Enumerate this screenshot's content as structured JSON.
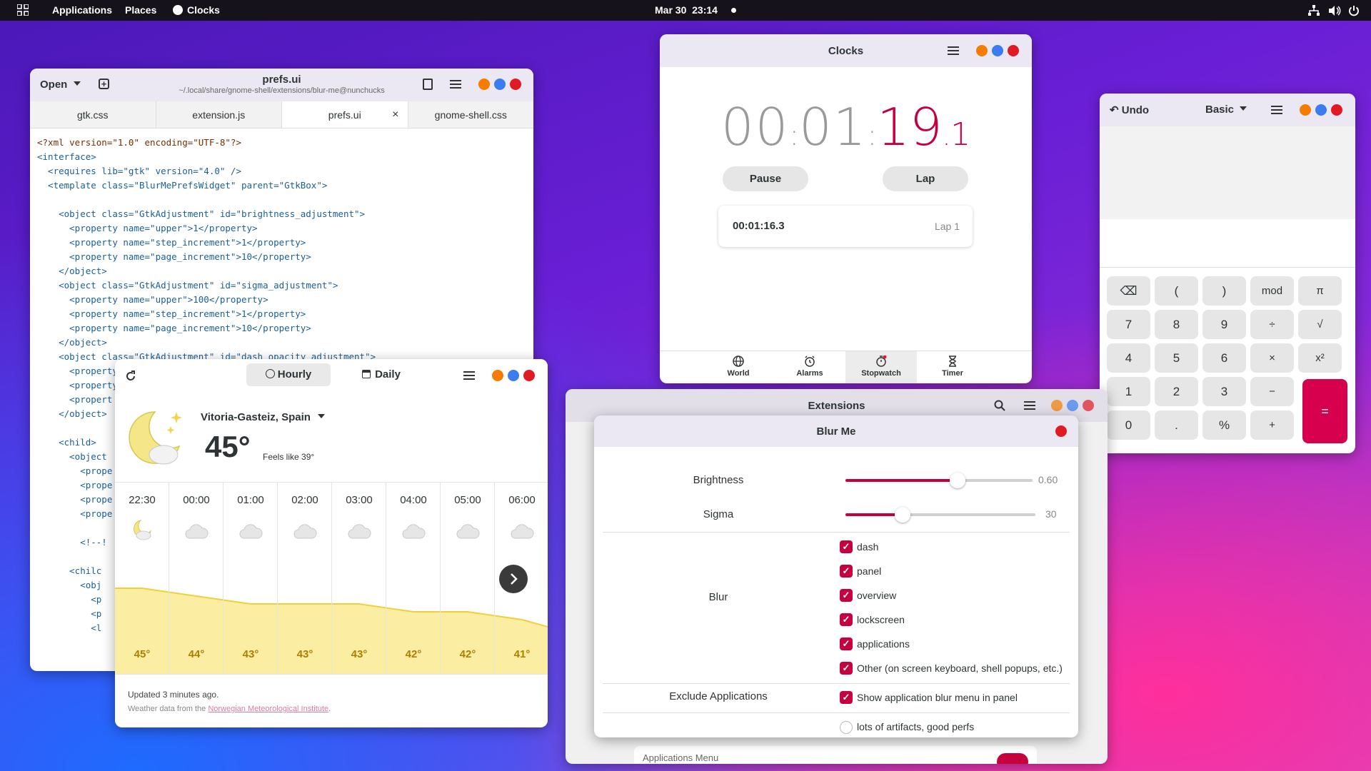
{
  "topbar": {
    "activities_icon": "grid-icon",
    "applications": "Applications",
    "places": "Places",
    "app": "Clocks",
    "clock": "Mar 30  23:14",
    "network_icon": "network-icon",
    "volume_icon": "volume-icon",
    "power_icon": "power-icon"
  },
  "editor": {
    "open": "Open",
    "title": "prefs.ui",
    "subtitle": "~/.local/share/gnome-shell/extensions/blur-me@nunchucks",
    "tabs": [
      {
        "label": "gtk.css"
      },
      {
        "label": "extension.js"
      },
      {
        "label": "prefs.ui",
        "active": true,
        "close": "×"
      },
      {
        "label": "gnome-shell.css"
      }
    ],
    "lines": [
      "<?xml version=\"1.0\" encoding=\"UTF-8\"?>",
      "<interface>",
      "  <requires lib=\"gtk\" version=\"4.0\" />",
      "  <template class=\"BlurMePrefsWidget\" parent=\"GtkBox\">",
      "",
      "    <object class=\"GtkAdjustment\" id=\"brightness_adjustment\">",
      "      <property name=\"upper\">1</property>",
      "      <property name=\"step_increment\">1</property>",
      "      <property name=\"page_increment\">10</property>",
      "    </object>",
      "    <object class=\"GtkAdjustment\" id=\"sigma_adjustment\">",
      "      <property name=\"upper\">100</property>",
      "      <property name=\"step_increment\">1</property>",
      "      <property name=\"page_increment\">10</property>",
      "    </object>",
      "    <object class=\"GtkAdjustment\" id=\"dash_opacity_adjustment\">",
      "      <property name=\"upper\">1</property>",
      "      <property name=\"step_increment\">1</property>",
      "      <propert",
      "    </object>",
      "",
      "    <child>",
      "      <object",
      "        <prope",
      "        <prope",
      "        <prope",
      "        <prope",
      "",
      "        <!--!",
      "",
      "      <chilc",
      "        <obj",
      "          <p",
      "          <p",
      "          <l"
    ]
  },
  "clocks": {
    "title": "Clocks",
    "hours": "00",
    "minutes": "01",
    "seconds": "19",
    "tenths": "1",
    "pause": "Pause",
    "lap": "Lap",
    "lap_time": "00:01:16.3",
    "lap_label": "Lap 1",
    "nav": [
      {
        "label": "World",
        "icon": "globe-icon"
      },
      {
        "label": "Alarms",
        "icon": "alarm-icon"
      },
      {
        "label": "Stopwatch",
        "icon": "stopwatch-icon",
        "active": true
      },
      {
        "label": "Timer",
        "icon": "hourglass-icon"
      }
    ]
  },
  "calculator": {
    "undo": "Undo",
    "mode": "Basic",
    "keys": [
      [
        "⌫",
        "(",
        ")",
        "mod",
        "π"
      ],
      [
        "7",
        "8",
        "9",
        "÷",
        "√"
      ],
      [
        "4",
        "5",
        "6",
        "×",
        "x²"
      ],
      [
        "1",
        "2",
        "3",
        "−",
        ""
      ],
      [
        "0",
        ".",
        "%",
        "+",
        ""
      ]
    ],
    "equals": "="
  },
  "weather": {
    "hourly": "Hourly",
    "daily": "Daily",
    "location": "Vitoria-Gasteiz, Spain",
    "temp": "45°",
    "feels": "Feels like 39°",
    "hours": [
      {
        "time": "22:30",
        "temp": "45°"
      },
      {
        "time": "00:00",
        "temp": "44°"
      },
      {
        "time": "01:00",
        "temp": "43°"
      },
      {
        "time": "02:00",
        "temp": "43°"
      },
      {
        "time": "03:00",
        "temp": "43°"
      },
      {
        "time": "04:00",
        "temp": "42°"
      },
      {
        "time": "05:00",
        "temp": "42°"
      },
      {
        "time": "06:00",
        "temp": "41°"
      }
    ],
    "updated": "Updated 3 minutes ago.",
    "source_prefix": "Weather data from the ",
    "source_link": "Norwegian Meteorological Institute",
    "source_suffix": "."
  },
  "extensions": {
    "title": "Extensions",
    "behind_row": "Applications Menu"
  },
  "blurme": {
    "title": "Blur Me",
    "brightness_label": "Brightness",
    "brightness_value": "0.60",
    "brightness_level": 0.6,
    "sigma_label": "Sigma",
    "sigma_value": "30",
    "sigma_level": 0.3,
    "blur_label": "Blur",
    "blur_options": [
      "dash",
      "panel",
      "overview",
      "lockscreen",
      "applications",
      "Other (on screen keyboard, shell popups, etc.)"
    ],
    "exclude_label": "Exclude Applications",
    "exclude_option": "Show application blur menu in panel",
    "radio_option": "lots of artifacts, good perfs"
  },
  "colors": {
    "accent": "#c6003e",
    "calc_equals": "#d6004f",
    "stopwatch_seconds": "#c6003e"
  }
}
